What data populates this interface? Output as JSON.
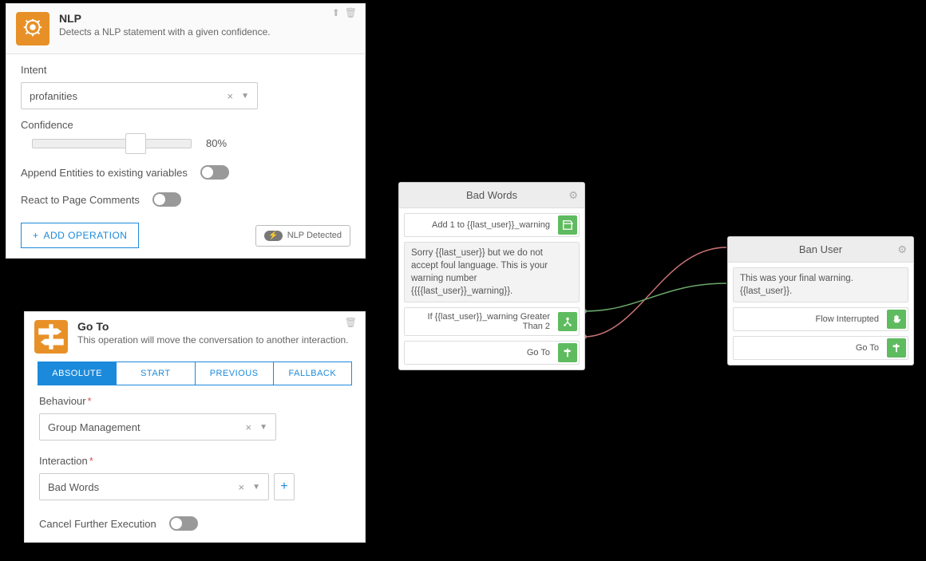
{
  "nlp": {
    "title": "NLP",
    "desc": "Detects a NLP statement with a given confidence.",
    "intent_label": "Intent",
    "intent_value": "profanities",
    "confidence_label": "Confidence",
    "confidence_value": "80%",
    "append_label": "Append Entities to existing variables",
    "react_label": "React to Page Comments",
    "add_op_label": "ADD OPERATION",
    "detected_label": "NLP Detected",
    "detected_badge": "⚡"
  },
  "goto": {
    "title": "Go To",
    "desc": "This operation will move the conversation to another interaction.",
    "tabs": {
      "absolute": "ABSOLUTE",
      "start": "START",
      "previous": "PREVIOUS",
      "fallback": "FALLBACK"
    },
    "behaviour_label": "Behaviour",
    "behaviour_value": "Group Management",
    "interaction_label": "Interaction",
    "interaction_value": "Bad Words",
    "cancel_label": "Cancel Further Execution"
  },
  "badwords": {
    "title": "Bad Words",
    "item1": "Add 1 to {{last_user}}_warning",
    "msg": "Sorry {{last_user}} but we do not accept foul language. This is your warning number {{{{last_user}}_warning}}.",
    "item3": "If {{last_user}}_warning Greater Than 2",
    "item4": "Go To"
  },
  "banuser": {
    "title": "Ban User",
    "msg": "This was your final warning. {{last_user}}.",
    "item2": "Flow Interrupted",
    "item3": "Go To"
  }
}
